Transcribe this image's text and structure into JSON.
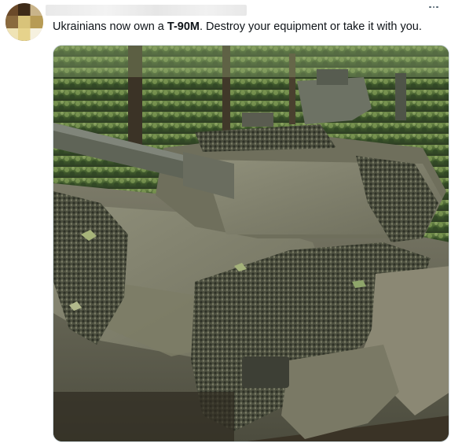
{
  "tweet": {
    "text_before": "Ukrainians now own a ",
    "text_bold": "T-90M",
    "text_after": ". Destroy your equipment or take it with you.",
    "more_label": "More",
    "more_icon": "more-horizontal-icon"
  },
  "colors": {
    "text": "#0f1419",
    "secondary": "#536471",
    "border": "#cfd9de"
  }
}
